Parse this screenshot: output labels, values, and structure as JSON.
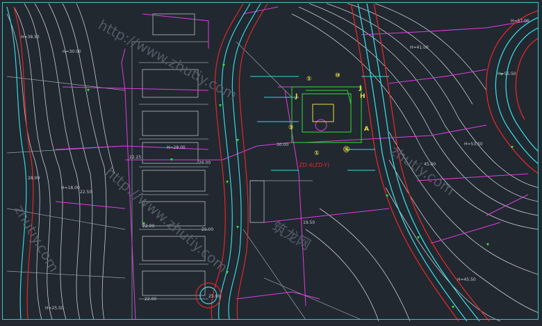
{
  "colors": {
    "background": "#212830",
    "contour": "#c8ccd2",
    "boundary": "#e03ce0",
    "road_red": "#e02828",
    "road_cyan": "#38d8e0",
    "marker_green": "#30e030",
    "marker_yellow": "#e8e040",
    "watermark": "#5a6470"
  },
  "elevations": [
    {
      "id": "h30",
      "text": "H=30.00"
    },
    {
      "id": "h28",
      "text": "H=28.00"
    },
    {
      "id": "h18",
      "text": "H=18.00"
    },
    {
      "id": "v28",
      "text": "28.00"
    },
    {
      "id": "v225",
      "text": "22.50"
    },
    {
      "id": "v22",
      "text": "22.00"
    },
    {
      "id": "v25",
      "text": "25.00"
    },
    {
      "id": "v2225",
      "text": "22.25"
    },
    {
      "id": "v2600",
      "text": "26.00"
    },
    {
      "id": "v3000",
      "text": "30.00"
    },
    {
      "id": "v1950",
      "text": "19.50"
    },
    {
      "id": "v2200b",
      "text": "22.00"
    },
    {
      "id": "v2500b",
      "text": "25.00"
    },
    {
      "id": "h2550",
      "text": "H=25.50"
    },
    {
      "id": "h41",
      "text": "H=41.00"
    },
    {
      "id": "h5550",
      "text": "H=55.50"
    },
    {
      "id": "h5350",
      "text": "H=53.50"
    },
    {
      "id": "h57",
      "text": "H=57.00"
    },
    {
      "id": "h4550",
      "text": "H=45.50"
    },
    {
      "id": "v4500",
      "text": "45.00"
    },
    {
      "id": "h3850",
      "text": "H=38.50"
    }
  ],
  "markers": [
    {
      "id": "m1a",
      "text": "①"
    },
    {
      "id": "m10a",
      "text": "⑩"
    },
    {
      "id": "mJa",
      "text": "J"
    },
    {
      "id": "mJb",
      "text": "J"
    },
    {
      "id": "mHa",
      "text": "H"
    },
    {
      "id": "m3",
      "text": "③"
    },
    {
      "id": "mA",
      "text": "A"
    },
    {
      "id": "m1b",
      "text": "①"
    },
    {
      "id": "m16",
      "text": "⑯"
    }
  ],
  "red_note": "ZD:4(ZD-Y)",
  "watermarks": [
    {
      "id": "w1",
      "text": "http://www.zhutiy.com"
    },
    {
      "id": "w2",
      "text": "http://www.zhutiy.com"
    },
    {
      "id": "w3",
      "text": "zhutiy.com"
    },
    {
      "id": "w4",
      "text": "zhutiy.com"
    },
    {
      "id": "w5",
      "text": "筑龙网"
    }
  ]
}
